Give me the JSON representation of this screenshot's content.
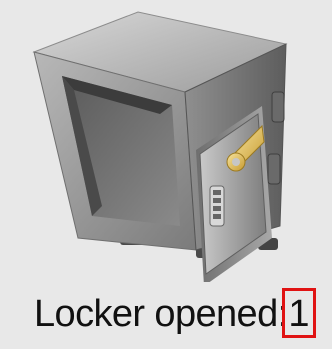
{
  "status": {
    "label": "Locker opened:",
    "count": "1"
  },
  "illustration": {
    "icon": "open-safe-icon",
    "highlight_color": "#e01313"
  }
}
